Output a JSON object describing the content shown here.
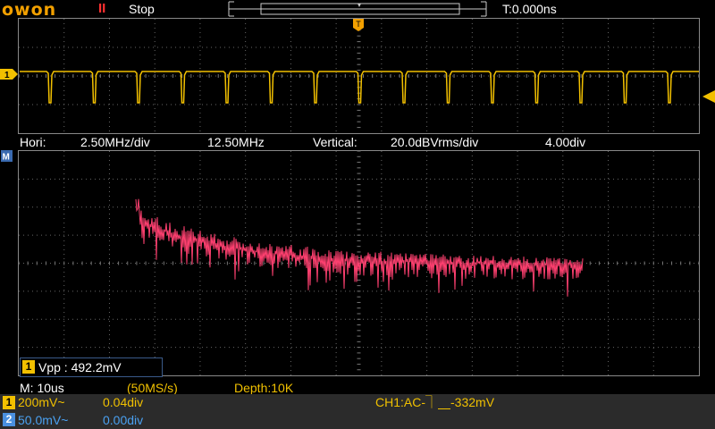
{
  "header": {
    "brand": "owon",
    "pause_glyph": "II",
    "run_status": "Stop",
    "time_offset": "T:0.000ns",
    "trigger_marker": "T"
  },
  "channel_markers": {
    "ch1": "1",
    "math": "M"
  },
  "fft_info": {
    "hori_label": "Hori:",
    "hori_div": "2.50MHz/div",
    "hori_center": "12.50MHz",
    "vert_label": "Vertical:",
    "vert_div": "20.0dBVrms/div",
    "vert_pos": "4.00div"
  },
  "measurement": {
    "badge": "1",
    "text": "Vpp : 492.2mV"
  },
  "acquisition": {
    "timebase": "M: 10us",
    "sample_rate": "(50MS/s)",
    "depth": "Depth:10K"
  },
  "channels": [
    {
      "badge": "1",
      "volt": "200mV~",
      "pos": "0.04div"
    },
    {
      "badge": "2",
      "volt": "50.0mV~",
      "pos": "0.00div"
    }
  ],
  "trigger": {
    "text": "CH1:AC-⏋⎽-332mV"
  },
  "colors": {
    "ch1": "#f2c000",
    "ch2": "#4a90e0",
    "math": "#ff4070",
    "brand": "#f2a000"
  }
}
